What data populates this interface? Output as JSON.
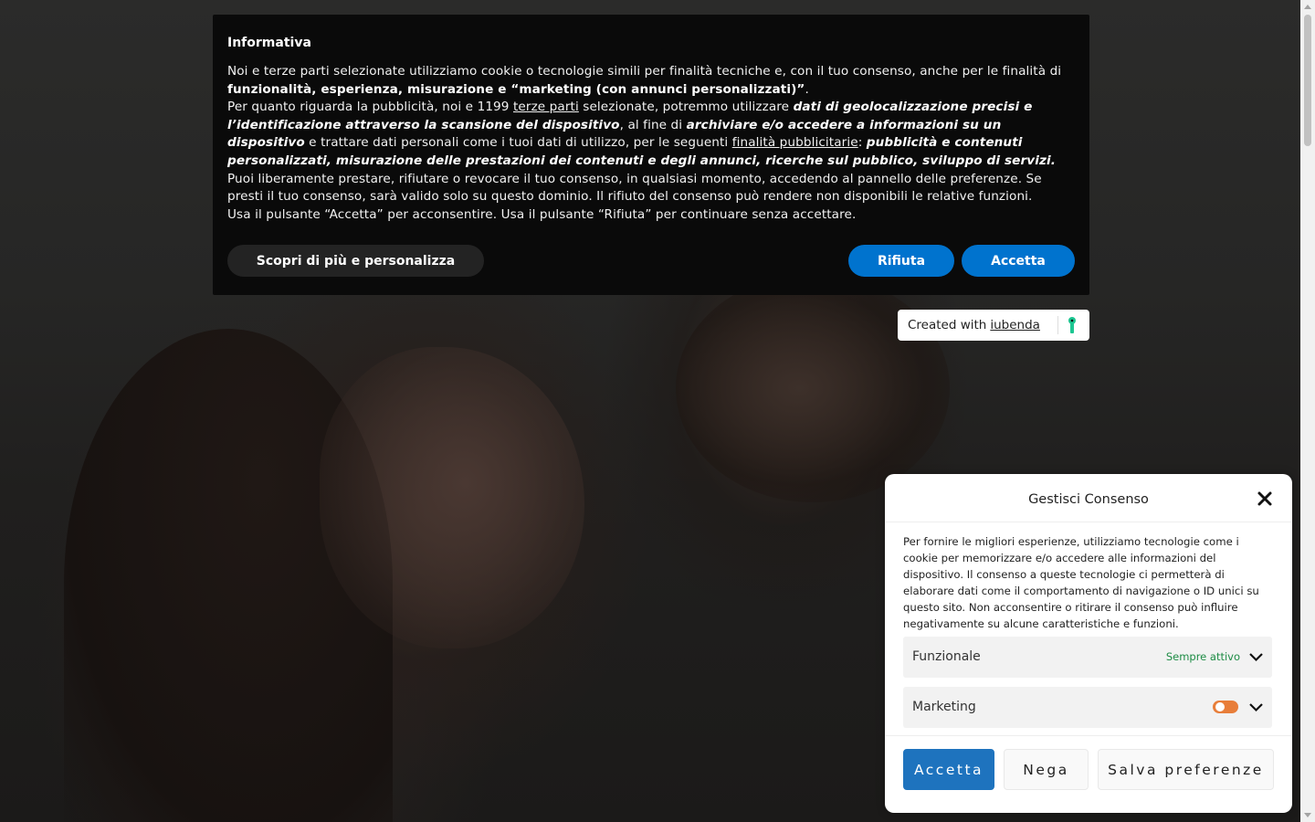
{
  "iubenda": {
    "title": "Informativa",
    "p1_a": "Noi e terze parti selezionate utilizziamo cookie o tecnologie simili per finalità tecniche e, con il tuo consenso, anche per le finalità di ",
    "p1_b": "funzionalità, esperienza, misurazione e “marketing (con annunci personalizzati)”",
    "p1_c": ".",
    "p2_a": "Per quanto riguarda la pubblicità, noi e 1199 ",
    "p2_link": "terze parti",
    "p2_b": " selezionate, potremmo utilizzare ",
    "p2_c": "dati di geolocalizzazione precisi e l’identificazione attraverso la scansione del dispositivo",
    "p2_d": ", al fine di ",
    "p2_e": "archiviare e/o accedere a informazioni su un dispositivo",
    "p2_f": " e trattare dati personali come i tuoi dati di utilizzo, per le seguenti ",
    "p2_link2": "finalità pubblicitarie",
    "p2_g": ": ",
    "p2_h": "pubblicità e contenuti personalizzati, misurazione delle prestazioni dei contenuti e degli annunci, ricerche sul pubblico, sviluppo di servizi.",
    "p3": "Puoi liberamente prestare, rifiutare o revocare il tuo consenso, in qualsiasi momento, accedendo al pannello delle preferenze. Se presti il tuo consenso, sarà valido solo su questo dominio. Il rifiuto del consenso può rendere non disponibili le relative funzioni.",
    "p4": "Usa il pulsante “Accetta” per acconsentire. Usa il pulsante “Rifiuta” per continuare senza accettare.",
    "btn_customize": "Scopri di più e personalizza",
    "btn_reject": "Rifiuta",
    "btn_accept": "Accetta",
    "badge_text": "Created with",
    "badge_link": "iubenda"
  },
  "consent": {
    "title": "Gestisci Consenso",
    "body": "Per fornire le migliori esperienze, utilizziamo tecnologie come i cookie per memorizzare e/o accedere alle informazioni del dispositivo. Il consenso a queste tecnologie ci permetterà di elaborare dati come il comportamento di navigazione o ID unici su questo sito. Non acconsentire o ritirare il consenso può influire negativamente su alcune caratteristiche e funzioni.",
    "categories": [
      {
        "label": "Funzionale",
        "status": "Sempre attivo"
      },
      {
        "label": "Marketing",
        "status": ""
      }
    ],
    "btn_accept": "Accetta",
    "btn_deny": "Nega",
    "btn_save": "Salva preferenze"
  },
  "colors": {
    "primary_blue": "#0073ce",
    "consent_blue": "#1e73be",
    "toggle_orange": "#e87e3a",
    "always_active_green": "#1e8c45"
  },
  "icons": [
    "close-icon",
    "chevron-down-icon",
    "iubenda-leaf-icon"
  ]
}
